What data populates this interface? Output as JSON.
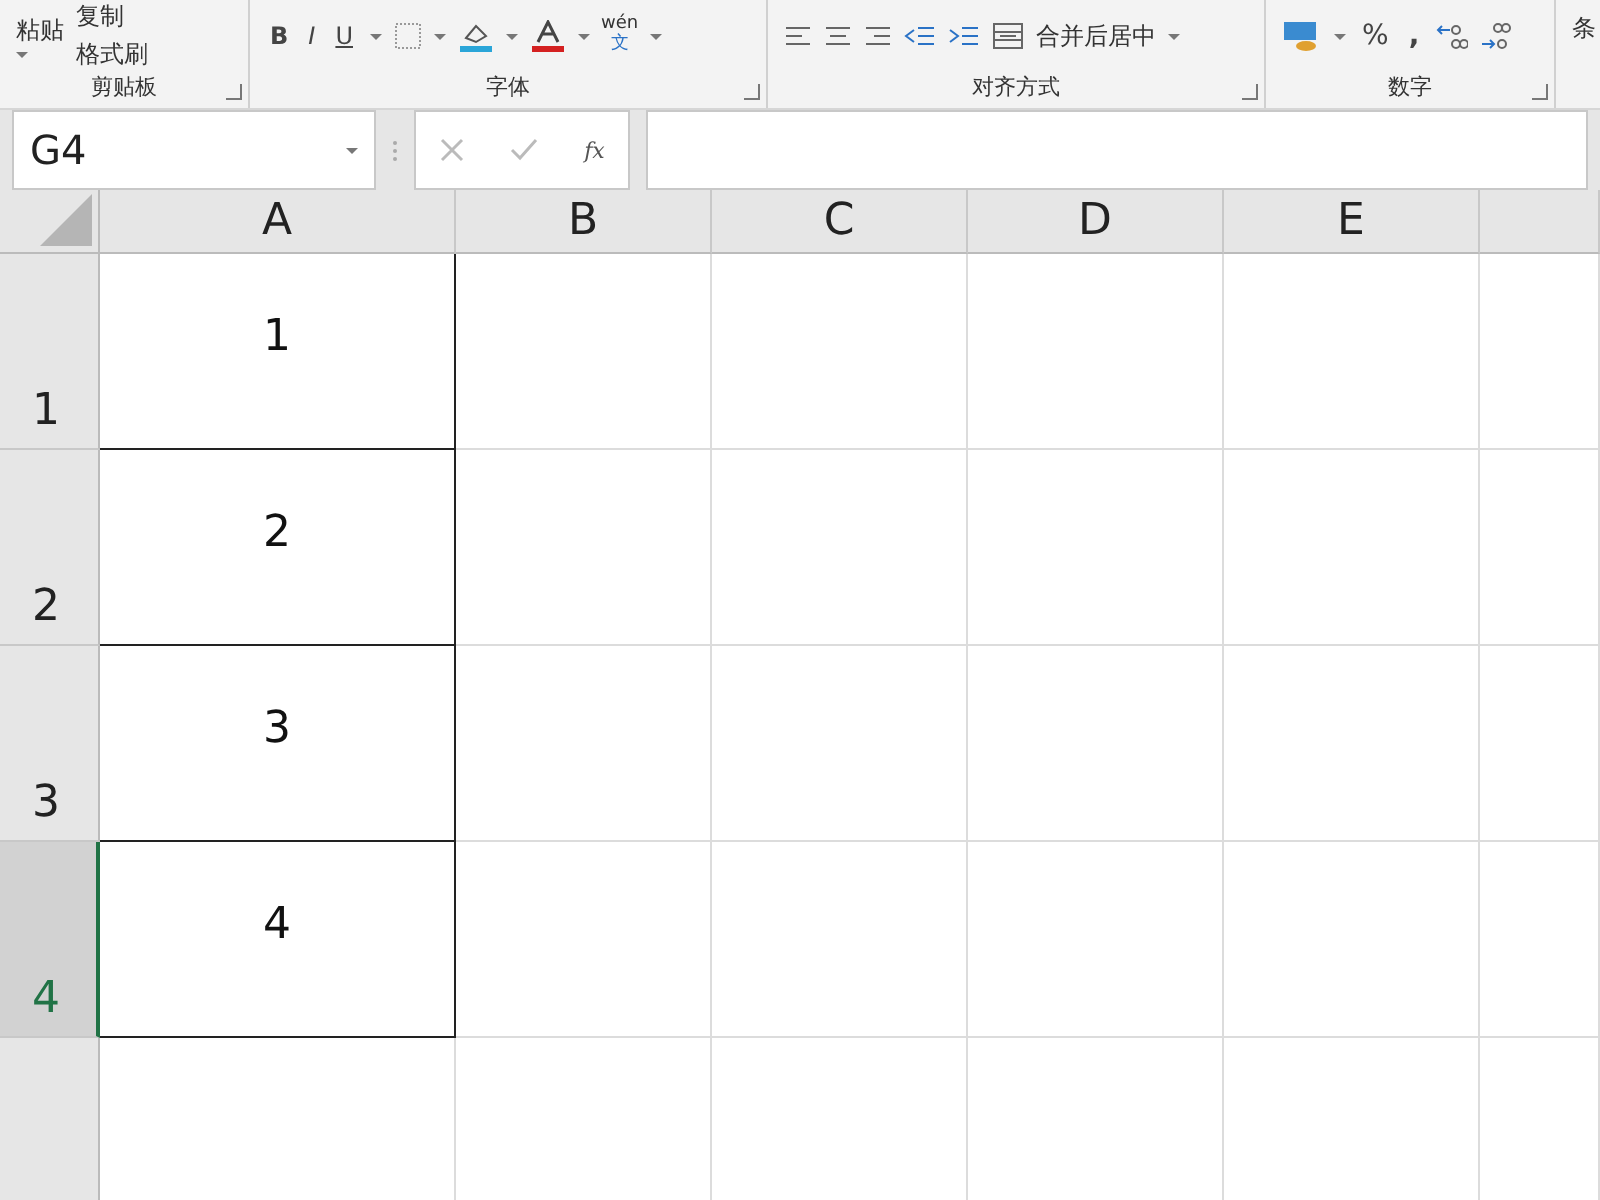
{
  "ribbon": {
    "groups": [
      {
        "kind": "clipboard",
        "label": "剪贴板",
        "paste": "粘贴",
        "copy": "复制",
        "painter": "格式刷"
      },
      {
        "kind": "font",
        "label": "字体",
        "bold": "B",
        "italic": "I",
        "underline": "U",
        "phonetic_top": "wén",
        "phonetic_bottom": "文"
      },
      {
        "kind": "align",
        "label": "对齐方式",
        "merge": "合并后居中"
      },
      {
        "kind": "number",
        "label": "数字",
        "percent": "%",
        "comma": ","
      },
      {
        "kind": "styles",
        "partial": "条"
      }
    ]
  },
  "formula_bar": {
    "name_box": "G4",
    "fx": "fx"
  },
  "sheet": {
    "columns": [
      {
        "label": "A",
        "selected": false
      },
      {
        "label": "B",
        "selected": false
      },
      {
        "label": "C",
        "selected": false
      },
      {
        "label": "D",
        "selected": false
      },
      {
        "label": "E",
        "selected": false
      },
      {
        "selected": false
      }
    ],
    "rows": [
      {
        "label": "1",
        "selected": false,
        "cells": [
          "1"
        ]
      },
      {
        "label": "2",
        "selected": false,
        "cells": [
          "2"
        ]
      },
      {
        "label": "3",
        "selected": false,
        "cells": [
          "3"
        ]
      },
      {
        "label": "4",
        "selected": true,
        "cells": [
          "4"
        ]
      },
      {
        "selected": false,
        "cells": []
      }
    ]
  }
}
